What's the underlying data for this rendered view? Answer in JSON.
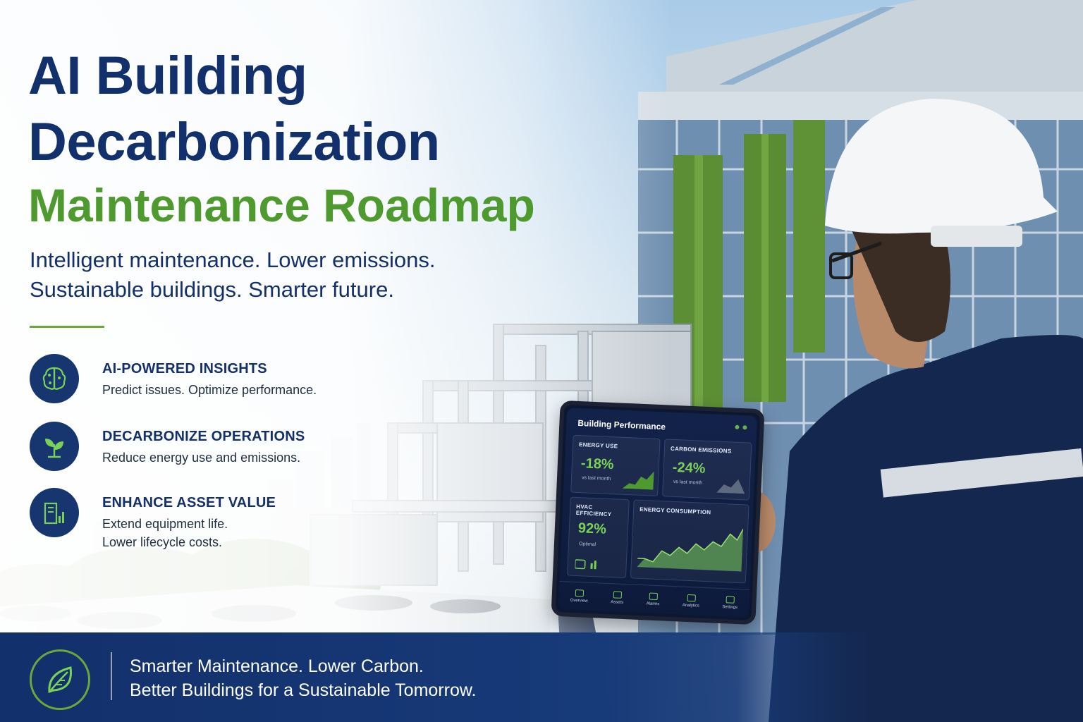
{
  "headline": {
    "line1": "AI Building",
    "line2": "Decarbonization",
    "line3": "Maintenance Roadmap"
  },
  "subtitle": {
    "line1": "Intelligent maintenance. Lower emissions.",
    "line2": "Sustainable buildings. Smarter future."
  },
  "features": [
    {
      "icon": "brain-circuit-icon",
      "title": "AI-POWERED INSIGHTS",
      "desc1": "Predict issues. Optimize performance.",
      "desc2": ""
    },
    {
      "icon": "leaf-plant-icon",
      "title": "DECARBONIZE OPERATIONS",
      "desc1": "Reduce energy use and emissions.",
      "desc2": ""
    },
    {
      "icon": "building-chart-icon",
      "title": "ENHANCE ASSET VALUE",
      "desc1": "Extend equipment life.",
      "desc2": "Lower lifecycle costs."
    }
  ],
  "tablet": {
    "title": "Building Performance",
    "energy_use": {
      "label": "ENERGY USE",
      "value": "-18%",
      "sub": "vs last month"
    },
    "carbon": {
      "label": "CARBON EMISSIONS",
      "value": "-24%",
      "sub": "vs last month"
    },
    "hvac": {
      "label": "HVAC EFFICIENCY",
      "value": "92%",
      "sub": "Optimal"
    },
    "consumption": {
      "label": "ENERGY CONSUMPTION"
    },
    "tabs": [
      "Overview",
      "Assets",
      "Alarms",
      "Analytics",
      "Settings"
    ]
  },
  "footer": {
    "icon": "leaf-badge-icon",
    "line1": "Smarter Maintenance. Lower Carbon.",
    "line2": "Better Buildings for a Sustainable Tomorrow."
  },
  "colors": {
    "navy": "#12306b",
    "green": "#4f9a2e",
    "accent_green": "#7bd158"
  }
}
